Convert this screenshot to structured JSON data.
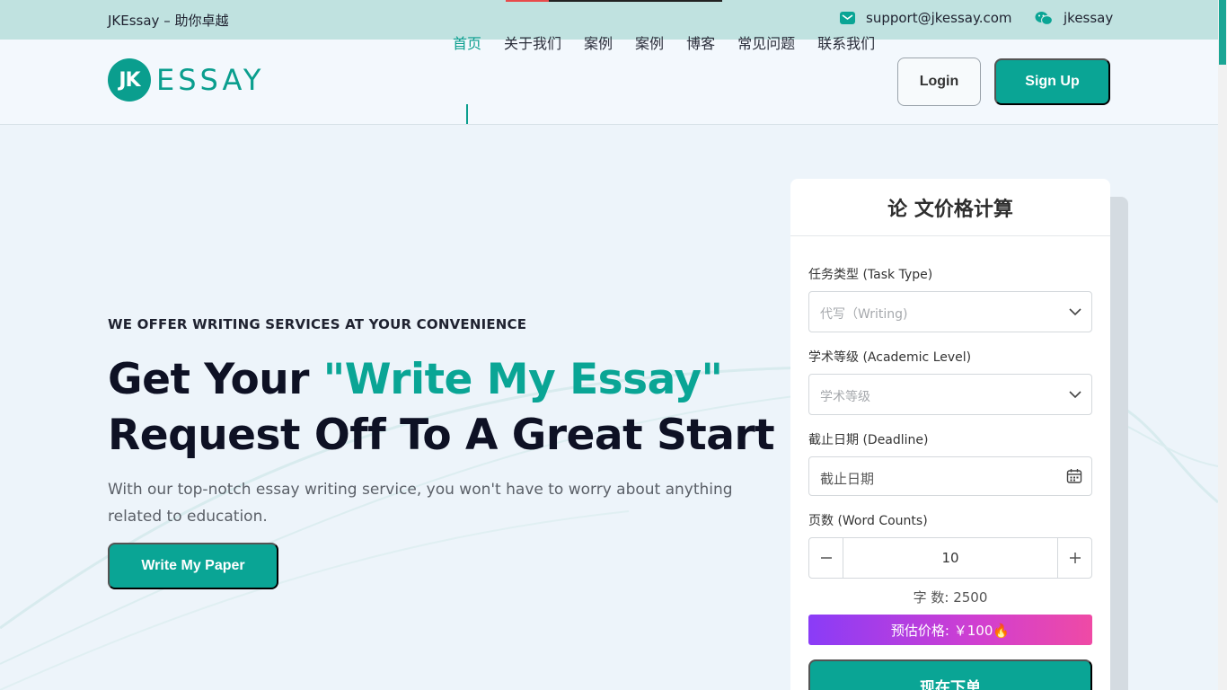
{
  "topbar": {
    "tagline": "JKEssay – 助你卓越",
    "email": "support@jkessay.com",
    "wechat": "jkessay",
    "load_progress": 0.2
  },
  "header": {
    "logo_badge": "JK",
    "logo_word": "ESSAY",
    "nav": [
      {
        "label": "首页",
        "active": true
      },
      {
        "label": "关于我们",
        "active": false
      },
      {
        "label": "案例",
        "active": false
      },
      {
        "label": "案例",
        "active": false
      },
      {
        "label": "博客",
        "active": false
      },
      {
        "label": "常见问题",
        "active": false
      },
      {
        "label": "联系我们",
        "active": false
      }
    ],
    "login_label": "Login",
    "signup_label": "Sign Up"
  },
  "hero": {
    "eyebrow": "WE OFFER WRITING SERVICES AT YOUR CONVENIENCE",
    "headline_part1": "Get Your ",
    "headline_accent": "\"Write My Essay\"",
    "headline_part2": "Request Off To A Great Start",
    "subtext": "With our top-notch essay writing service, you won't have to worry about anything related to education.",
    "cta_label": "Write My Paper"
  },
  "calculator": {
    "title": "论 文价格计算",
    "task_type_label": "任务类型 (Task Type)",
    "task_type_placeholder": "代写（Writing)",
    "academic_level_label": "学术等级 (Academic Level)",
    "academic_level_placeholder": "学术等级",
    "deadline_label": "截止日期 (Deadline)",
    "deadline_placeholder": "截止日期",
    "pages_label": "页数 (Word Counts)",
    "pages_value": "10",
    "word_count_text": "字 数: 2500",
    "price_text": "预估价格: ￥100🔥",
    "order_label": "现在下单"
  },
  "colors": {
    "brand": "#0aa595",
    "topbar_bg": "#c0e2e0",
    "page_bg": "#edf4fa",
    "price_gradient_start": "#8a3cf7",
    "price_gradient_end": "#ef4aa5"
  },
  "icons": [
    "mail-icon",
    "wechat-icon",
    "chevron-down-icon",
    "calendar-icon",
    "minus-icon",
    "plus-icon"
  ]
}
